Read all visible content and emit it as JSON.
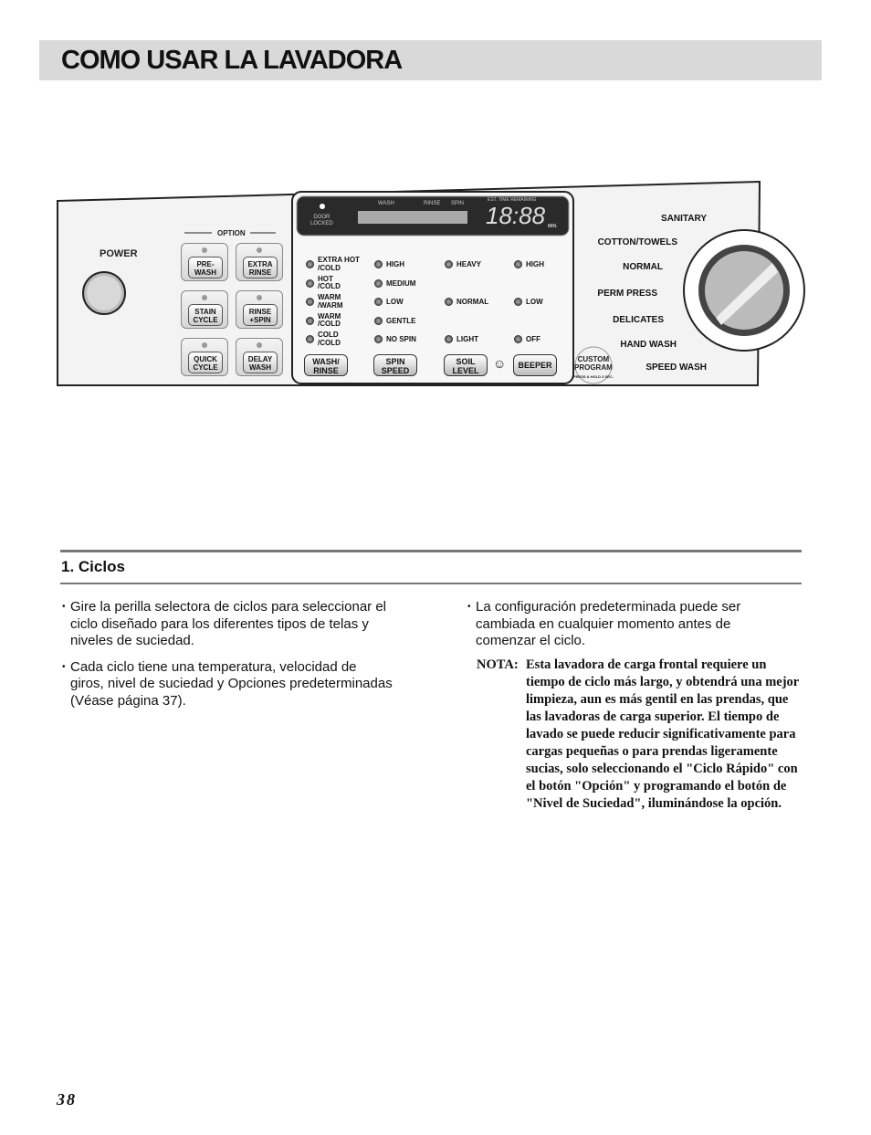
{
  "header": {
    "title": "COMO USAR LA LAVADORA"
  },
  "panel": {
    "power_label": "POWER",
    "option_label": "OPTION",
    "option_buttons": [
      {
        "l1": "PRE-",
        "l2": "WASH"
      },
      {
        "l1": "EXTRA",
        "l2": "RINSE"
      },
      {
        "l1": "STAIN",
        "l2": "CYCLE"
      },
      {
        "l1": "RINSE",
        "l2": "+SPIN"
      },
      {
        "l1": "QUICK",
        "l2": "CYCLE"
      },
      {
        "l1": "DELAY",
        "l2": "WASH"
      }
    ],
    "display": {
      "door_l1": "DOOR",
      "door_l2": "LOCKED",
      "wash": "WASH",
      "rinse": "RINSE",
      "spin": "SPIN",
      "est": "EST. TIME REMAINING",
      "time": "18:88",
      "min": "MIN."
    },
    "wash_rinse_opts": [
      {
        "l1": "EXTRA HOT",
        "l2": "/COLD"
      },
      {
        "l1": "HOT",
        "l2": "/COLD"
      },
      {
        "l1": "WARM",
        "l2": "/WARM"
      },
      {
        "l1": "WARM",
        "l2": "/COLD"
      },
      {
        "l1": "COLD",
        "l2": "/COLD"
      }
    ],
    "spin_opts": [
      "HIGH",
      "MEDIUM",
      "LOW",
      "GENTLE",
      "NO SPIN"
    ],
    "soil_opts": [
      "HEAVY",
      "NORMAL",
      "LIGHT"
    ],
    "beeper_opts": [
      "HIGH",
      "LOW",
      "OFF"
    ],
    "func_buttons": [
      {
        "l1": "WASH/",
        "l2": "RINSE"
      },
      {
        "l1": "SPIN",
        "l2": "SPEED"
      },
      {
        "l1": "SOIL",
        "l2": "LEVEL"
      },
      {
        "l1": "BEEPER",
        "l2": ""
      }
    ],
    "custom": {
      "l1": "CUSTOM",
      "l2": "PROGRAM",
      "l3": "PRESS & HOLD 3 SEC."
    },
    "cycles": [
      "SANITARY",
      "COTTON/TOWELS",
      "NORMAL",
      "PERM PRESS",
      "DELICATES",
      "HAND WASH",
      "SPEED WASH"
    ]
  },
  "section": {
    "title": "1. Ciclos"
  },
  "left_bullets": [
    "Gire la perilla selectora de ciclos para seleccionar el ciclo diseñado para los diferentes tipos de telas y niveles de suciedad.",
    "Cada ciclo tiene una temperatura, velocidad de giros, nivel de suciedad y Opciones predeterminadas (Véase página 37)."
  ],
  "right_bullets": [
    "La configuración predeterminada puede ser cambiada en cualquier momento antes de comenzar el ciclo."
  ],
  "nota": {
    "label": "NOTA:",
    "text": "Esta lavadora de carga frontal requiere un tiempo de ciclo más largo, y obtendrá una mejor limpieza, aun es más gentil en las prendas, que las lavadoras de carga superior. El tiempo de lavado se puede reducir significativamente para cargas pequeñas o para prendas ligeramente sucias, solo seleccionando el \"Ciclo Rápido\" con el botón \"Opción\" y programando el botón de \"Nivel de Suciedad\", iluminándose la opción."
  },
  "page_number": "38"
}
